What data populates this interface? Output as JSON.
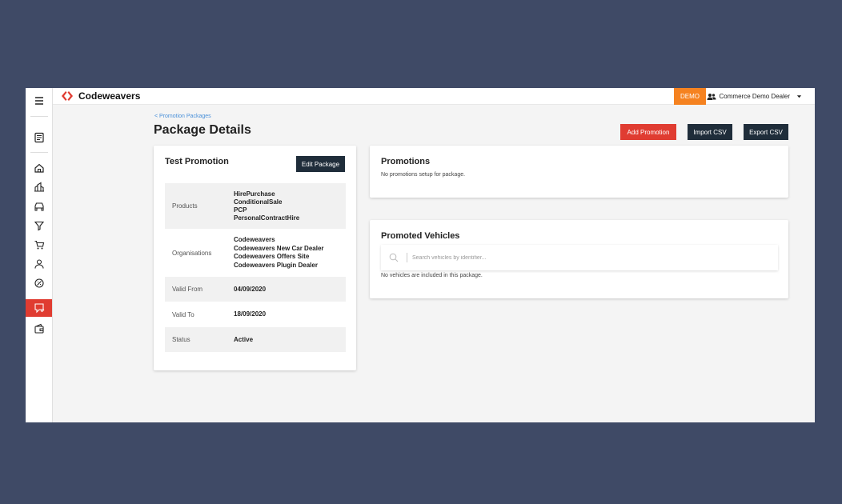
{
  "topbar": {
    "brand": "Codeweavers",
    "demo_badge": "DEMO",
    "dealer_name": "Commerce Demo Dealer"
  },
  "sidebar": {
    "items": [
      {
        "icon": "menu-icon"
      },
      {
        "icon": "report-icon"
      },
      {
        "icon": "home-icon"
      },
      {
        "icon": "dealership-icon"
      },
      {
        "icon": "car-icon"
      },
      {
        "icon": "filter-icon"
      },
      {
        "icon": "cart-icon"
      },
      {
        "icon": "user-icon"
      },
      {
        "icon": "badge-icon"
      },
      {
        "icon": "promotion-icon",
        "active": true
      },
      {
        "icon": "wallet-icon"
      }
    ]
  },
  "page": {
    "breadcrumb": "< Promotion Packages",
    "title": "Package Details"
  },
  "actions": {
    "add_promotion": "Add Promotion",
    "import_csv": "Import CSV",
    "export_csv": "Export CSV"
  },
  "package": {
    "name": "Test Promotion",
    "edit_label": "Edit Package",
    "details": [
      {
        "label": "Products",
        "values": [
          "HirePurchase",
          "ConditionalSale",
          "PCP",
          "PersonalContractHire"
        ]
      },
      {
        "label": "Organisations",
        "values": [
          "Codeweavers",
          "Codeweavers New Car Dealer",
          "Codeweavers Offers Site",
          "Codeweavers Plugin Dealer"
        ]
      },
      {
        "label": "Valid From",
        "values": [
          "04/09/2020"
        ]
      },
      {
        "label": "Valid To",
        "values": [
          "18/09/2020"
        ]
      },
      {
        "label": "Status",
        "values": [
          "Active"
        ]
      }
    ]
  },
  "promotions": {
    "title": "Promotions",
    "empty_text": "No promotions setup for package."
  },
  "vehicles": {
    "title": "Promoted Vehicles",
    "search_placeholder": "Search vehicles by identifier...",
    "empty_text": "No vehicles are included in this package."
  },
  "colors": {
    "accent_red": "#e03c31",
    "demo_orange": "#f58220",
    "dark_button": "#1f2d3a",
    "link_blue": "#4a90d9",
    "backdrop": "#3f4a66"
  }
}
